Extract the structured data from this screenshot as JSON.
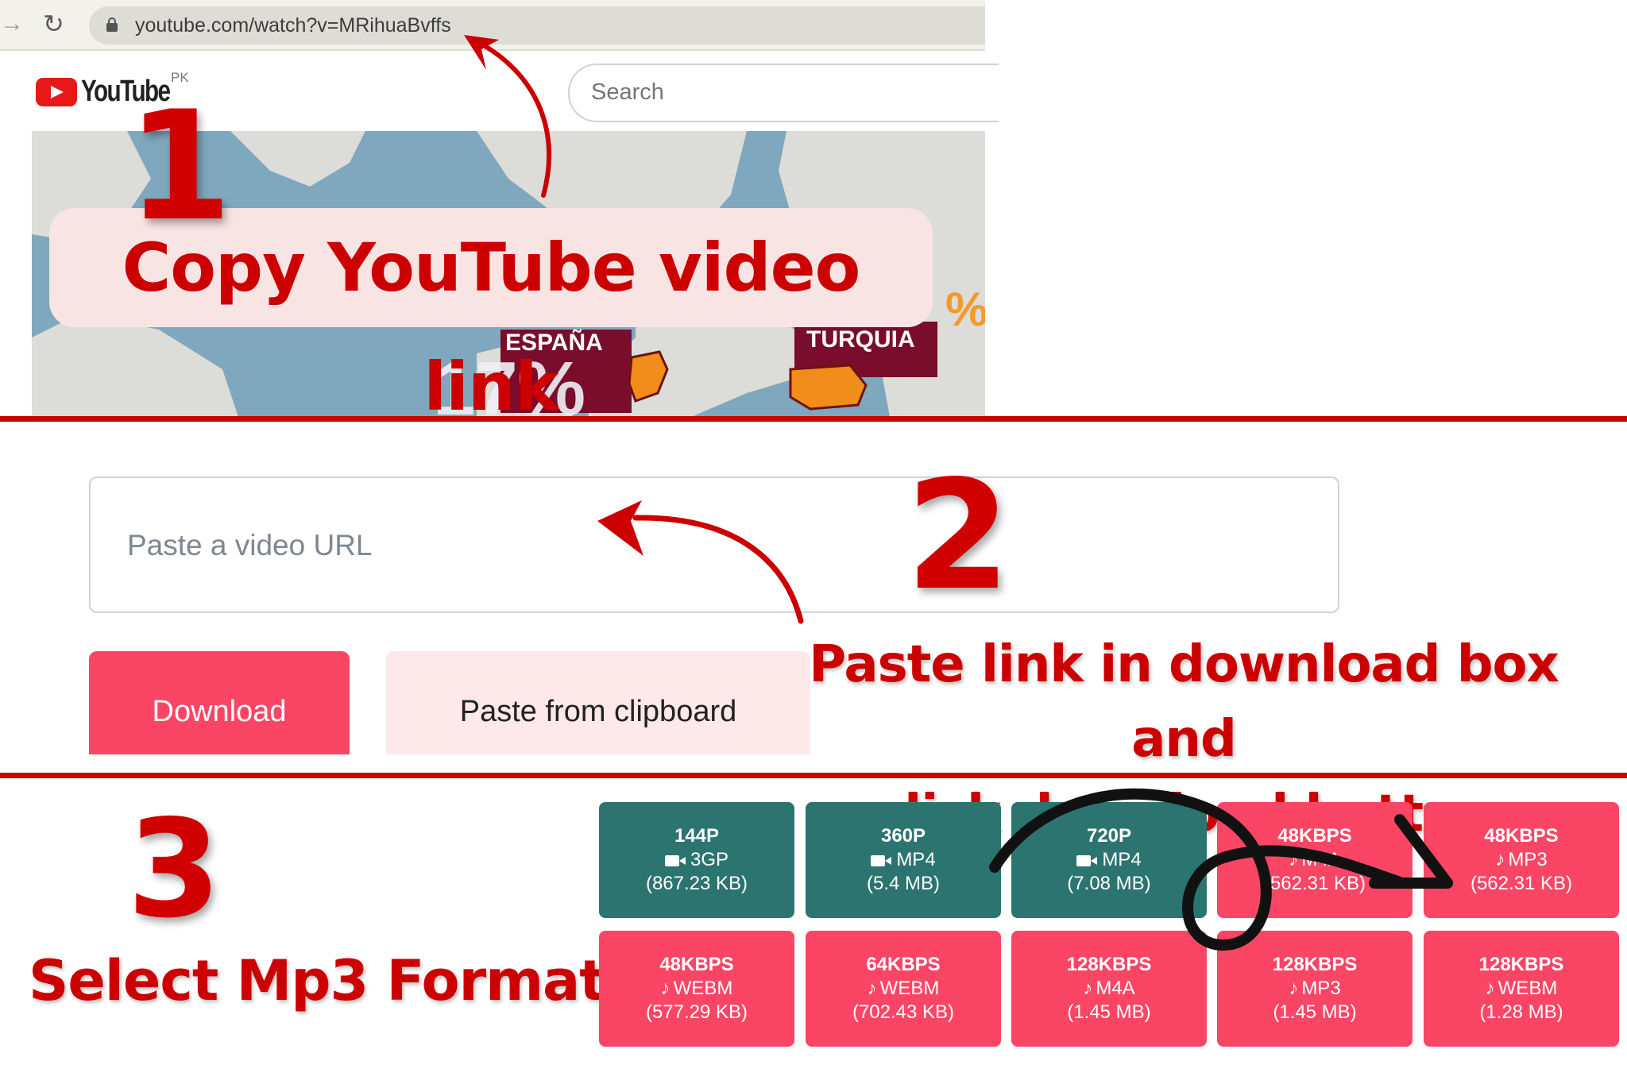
{
  "browser": {
    "url": "youtube.com/watch?v=MRihuaBvffs",
    "forward_icon": "→",
    "reload_icon": "↻"
  },
  "youtube": {
    "logo_text": "YouTube",
    "region": "PK",
    "search_placeholder": "Search"
  },
  "video_thumbnail": {
    "labels": [
      "ESPAÑA",
      "TURQUIA"
    ],
    "percent": "17%",
    "percent_partial": "%"
  },
  "steps": [
    {
      "number": "1",
      "text": "Copy YouTube video link"
    },
    {
      "number": "2",
      "text_line1": "Paste link in download box and",
      "text_line2": "click download button"
    },
    {
      "number": "3",
      "text": "Select Mp3 Format"
    }
  ],
  "downloader": {
    "url_placeholder": "Paste a video URL",
    "download_label": "Download",
    "paste_label": "Paste from clipboard"
  },
  "formats": [
    {
      "quality": "144P",
      "type": "video",
      "format": "3GP",
      "size": "(867.23 KB)"
    },
    {
      "quality": "360P",
      "type": "video",
      "format": "MP4",
      "size": "(5.4 MB)"
    },
    {
      "quality": "720P",
      "type": "video",
      "format": "MP4",
      "size": "(7.08 MB)"
    },
    {
      "quality": "48KBPS",
      "type": "audio",
      "format": "M4A",
      "size": "(562.31 KB)"
    },
    {
      "quality": "48KBPS",
      "type": "audio",
      "format": "MP3",
      "size": "(562.31 KB)"
    },
    {
      "quality": "48KBPS",
      "type": "audio",
      "format": "WEBM",
      "size": "(577.29 KB)"
    },
    {
      "quality": "64KBPS",
      "type": "audio",
      "format": "WEBM",
      "size": "(702.43 KB)"
    },
    {
      "quality": "128KBPS",
      "type": "audio",
      "format": "M4A",
      "size": "(1.45 MB)"
    },
    {
      "quality": "128KBPS",
      "type": "audio",
      "format": "MP3",
      "size": "(1.45 MB)"
    },
    {
      "quality": "128KBPS",
      "type": "audio",
      "format": "WEBM",
      "size": "(1.28 MB)"
    }
  ],
  "colors": {
    "accent_red": "#cc0000",
    "video_tile": "#2b7470",
    "audio_tile": "#fb4565",
    "download_button": "#fb4565",
    "paste_button": "#fde8ea",
    "callout_bg": "#f9e4e4"
  },
  "icons": {
    "audio": "music-note-icon",
    "video": "video-camera-icon",
    "music_glyph": "♪"
  }
}
